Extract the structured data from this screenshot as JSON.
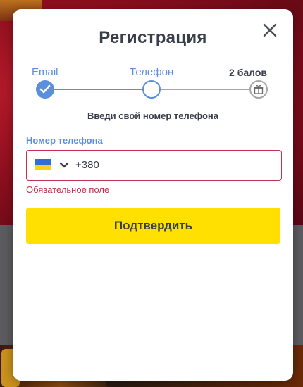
{
  "modal": {
    "title": "Регистрация",
    "close_icon": "close-icon"
  },
  "stepper": {
    "steps": [
      {
        "label": "Email",
        "state": "done",
        "icon": "check-icon"
      },
      {
        "label": "Телефон",
        "state": "current"
      },
      {
        "label": "2 балов",
        "state": "pending",
        "icon": "gift-icon"
      }
    ],
    "colors": {
      "active": "#5b8edb",
      "inactive": "#a6a6a6"
    }
  },
  "instruction": "Введи свой номер телефона",
  "phone": {
    "label": "Номер телефона",
    "country_flag": "ukraine-flag-icon",
    "dropdown_icon": "chevron-down-icon",
    "prefix": "+380",
    "value": "",
    "error": "Обязательное поле",
    "error_color": "#c2314e"
  },
  "submit": {
    "label": "Подтвердить",
    "color": "#ffe000"
  }
}
